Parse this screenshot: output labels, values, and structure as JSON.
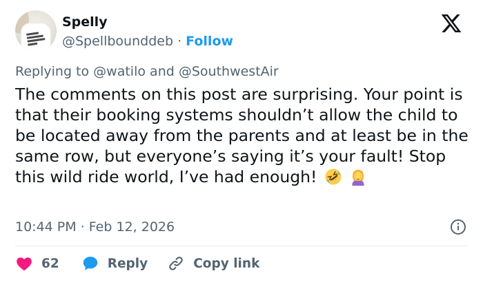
{
  "author": {
    "name": "Spelly",
    "handle": "@Spellbounddeb",
    "separator": "·",
    "follow_label": "Follow"
  },
  "reply_context": {
    "prefix": "Replying to",
    "mention_1": "@watilo",
    "conjunction": "and",
    "mention_2": "@SouthwestAir"
  },
  "tweet": {
    "text": "The comments on this post are surprising. Your point is that their booking systems shouldn’t allow the child to be located away from the parents and at least be in the same row, but everyone’s saying it’s your fault! Stop this wild ride world, I’ve had enough!",
    "emojis": [
      "rolling-on-floor-laughing-emoji",
      "facepalm-emoji"
    ],
    "time": "10:44 PM",
    "date_separator": "·",
    "date": "Feb 12, 2026"
  },
  "actions": {
    "like_count": "62",
    "reply_label": "Reply",
    "copy_link_label": "Copy link"
  },
  "icons": {
    "logo": "x-logo-icon",
    "info": "info-icon",
    "like": "heart-icon",
    "reply": "chat-bubble-icon",
    "copy": "link-icon"
  },
  "colors": {
    "accent": "#1d9bf0",
    "text": "#0f1419",
    "muted": "#536471",
    "like": "#f91880",
    "divider": "#e6e9ec"
  }
}
